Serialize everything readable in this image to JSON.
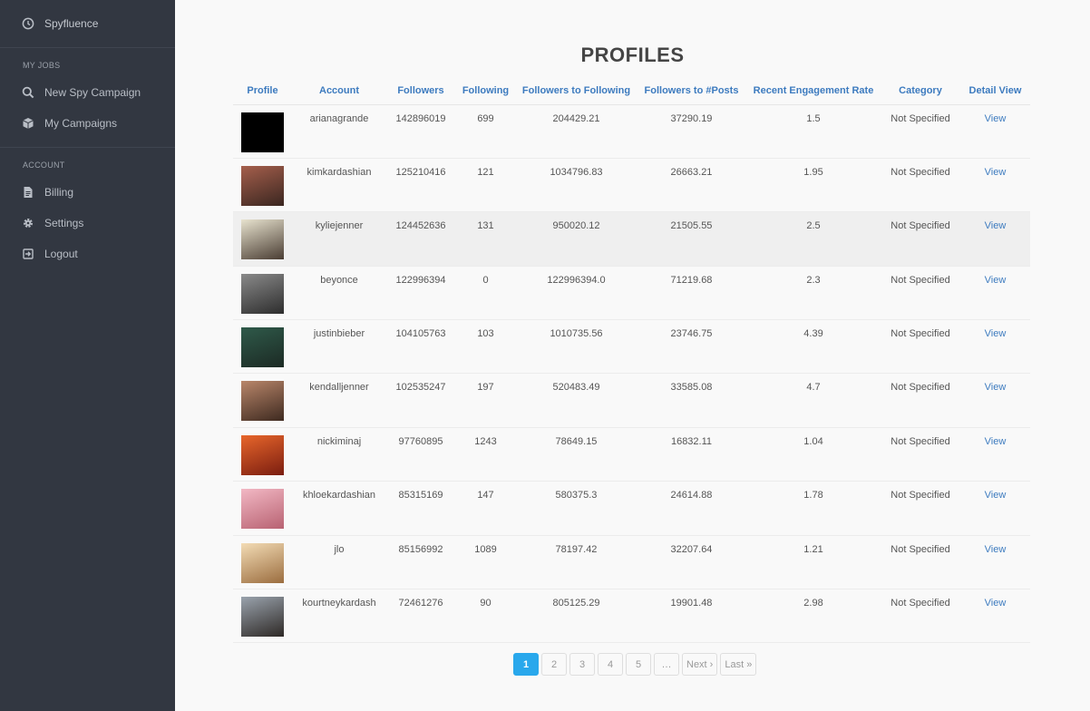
{
  "app": {
    "name": "Spyfluence"
  },
  "sidebar": {
    "sections": [
      {
        "label": "MY JOBS",
        "items": [
          {
            "label": "New Spy Campaign",
            "icon": "search-icon"
          },
          {
            "label": "My Campaigns",
            "icon": "cube-icon"
          }
        ]
      },
      {
        "label": "ACCOUNT",
        "items": [
          {
            "label": "Billing",
            "icon": "document-icon"
          },
          {
            "label": "Settings",
            "icon": "gear-icon"
          },
          {
            "label": "Logout",
            "icon": "logout-icon"
          }
        ]
      }
    ]
  },
  "page": {
    "title": "PROFILES"
  },
  "table": {
    "columns": [
      "Profile",
      "Account",
      "Followers",
      "Following",
      "Followers to Following",
      "Followers to #Posts",
      "Recent Engagement Rate",
      "Category",
      "Detail View"
    ],
    "rows": [
      {
        "account": "arianagrande",
        "followers": "142896019",
        "following": "699",
        "ratio_following": "204429.21",
        "ratio_posts": "37290.19",
        "engagement": "1.5",
        "category": "Not Specified",
        "view": "View",
        "thumb": [
          "#000000",
          "#000000"
        ]
      },
      {
        "account": "kimkardashian",
        "followers": "125210416",
        "following": "121",
        "ratio_following": "1034796.83",
        "ratio_posts": "26663.21",
        "engagement": "1.95",
        "category": "Not Specified",
        "view": "View",
        "thumb": [
          "#a55f4c",
          "#3a2620"
        ]
      },
      {
        "account": "kyliejenner",
        "followers": "124452636",
        "following": "131",
        "ratio_following": "950020.12",
        "ratio_posts": "21505.55",
        "engagement": "2.5",
        "category": "Not Specified",
        "view": "View",
        "thumb": [
          "#e8e3cf",
          "#4a3d33"
        ]
      },
      {
        "account": "beyonce",
        "followers": "122996394",
        "following": "0",
        "ratio_following": "122996394.0",
        "ratio_posts": "71219.68",
        "engagement": "2.3",
        "category": "Not Specified",
        "view": "View",
        "thumb": [
          "#8a8a8a",
          "#2d2d2d"
        ]
      },
      {
        "account": "justinbieber",
        "followers": "104105763",
        "following": "103",
        "ratio_following": "1010735.56",
        "ratio_posts": "23746.75",
        "engagement": "4.39",
        "category": "Not Specified",
        "view": "View",
        "thumb": [
          "#2f5a4a",
          "#1c2a24"
        ]
      },
      {
        "account": "kendalljenner",
        "followers": "102535247",
        "following": "197",
        "ratio_following": "520483.49",
        "ratio_posts": "33585.08",
        "engagement": "4.7",
        "category": "Not Specified",
        "view": "View",
        "thumb": [
          "#b9866a",
          "#3e2a20"
        ]
      },
      {
        "account": "nickiminaj",
        "followers": "97760895",
        "following": "1243",
        "ratio_following": "78649.15",
        "ratio_posts": "16832.11",
        "engagement": "1.04",
        "category": "Not Specified",
        "view": "View",
        "thumb": [
          "#e8662b",
          "#7a1d10"
        ]
      },
      {
        "account": "khloekardashian",
        "followers": "85315169",
        "following": "147",
        "ratio_following": "580375.3",
        "ratio_posts": "24614.88",
        "engagement": "1.78",
        "category": "Not Specified",
        "view": "View",
        "thumb": [
          "#f2b8c4",
          "#b86272"
        ]
      },
      {
        "account": "jlo",
        "followers": "85156992",
        "following": "1089",
        "ratio_following": "78197.42",
        "ratio_posts": "32207.64",
        "engagement": "1.21",
        "category": "Not Specified",
        "view": "View",
        "thumb": [
          "#f3dcb5",
          "#9b6d3f"
        ]
      },
      {
        "account": "kourtneykardash",
        "followers": "72461276",
        "following": "90",
        "ratio_following": "805125.29",
        "ratio_posts": "19901.48",
        "engagement": "2.98",
        "category": "Not Specified",
        "view": "View",
        "thumb": [
          "#9aa3ad",
          "#2e2926"
        ]
      }
    ]
  },
  "pagination": {
    "pages": [
      "1",
      "2",
      "3",
      "4",
      "5",
      "…"
    ],
    "next": "Next ›",
    "last": "Last »",
    "current": "1"
  },
  "colors": {
    "sidebar_bg": "#323741",
    "link": "#3d7bbf",
    "active_page": "#29a8ec"
  }
}
